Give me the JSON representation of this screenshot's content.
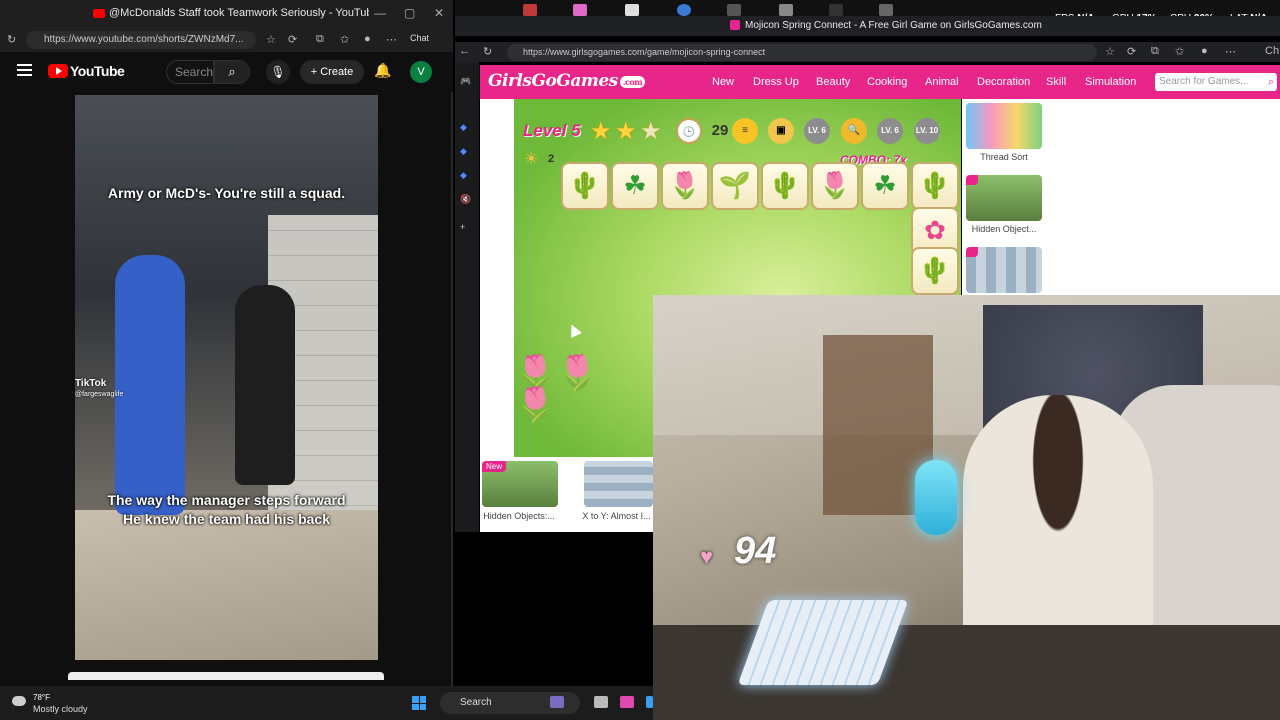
{
  "left_browser": {
    "tab_title": "@McDonalds Staff took Teamwork Seriously - YouTube",
    "url": "https://www.youtube.com/shorts/ZWNzMd7...",
    "chat_label": "Chat"
  },
  "youtube": {
    "logo_text": "YouTube",
    "search_placeholder": "Search",
    "create_label": "Create",
    "avatar_letter": "V",
    "caption_top": "Army or McD's- You're still a squad.",
    "caption_bottom_1": "The way the manager steps forward",
    "caption_bottom_2": "He knew the team had his back",
    "tiktok_label": "TikTok",
    "tiktok_handle": "@fargeswaglife"
  },
  "system_stats": {
    "fps_label": "FPS",
    "fps_value": "N/A",
    "gpu_label": "GPU",
    "gpu_value": "17%",
    "cpu_label": "CPU",
    "cpu_value": "20%",
    "lat_label": "LAT",
    "lat_value": "N/A"
  },
  "right_browser": {
    "tab_title": "Mojicon Spring Connect - A Free Girl Game on GirlsGoGames.com",
    "url": "https://www.girlsgogames.com/game/mojicon-spring-connect",
    "chat_label": "Ch"
  },
  "girlsgogames": {
    "logo": "GirlsGoGames",
    "logo_suffix": ".com",
    "nav": [
      "New",
      "Dress Up",
      "Beauty",
      "Cooking",
      "Animal",
      "Decoration",
      "Skill",
      "Simulation"
    ],
    "search_placeholder": "Search for Games...",
    "sidebar_games": [
      "Thread Sort",
      "Hidden Object...",
      ""
    ],
    "bottom_games": [
      {
        "label": "Hidden Objects:...",
        "badge": "New"
      },
      {
        "label": "X to Y: Almost I..."
      }
    ],
    "new_badge": "New"
  },
  "game": {
    "level_label": "Level 5",
    "stars": 3,
    "score_partial": "29",
    "circle_labels": [
      "LV. 6",
      "LV. 6",
      "LV. 10"
    ],
    "combo_label": "COMBO: 7x",
    "sun_count": "2",
    "tiles_row": [
      "cactus",
      "clover",
      "tulip",
      "sprout",
      "cactus",
      "tulip",
      "clover",
      "cactus"
    ],
    "tiles_col": [
      "flower",
      "cactus"
    ]
  },
  "webcam": {
    "heart_count": "94"
  },
  "taskbar": {
    "temperature": "78°F",
    "weather": "Mostly cloudy",
    "search_label": "Search"
  },
  "colors": {
    "ggg_pink": "#e8268a",
    "youtube_red": "#ff0000",
    "youtube_bg": "#0f0f0f"
  }
}
